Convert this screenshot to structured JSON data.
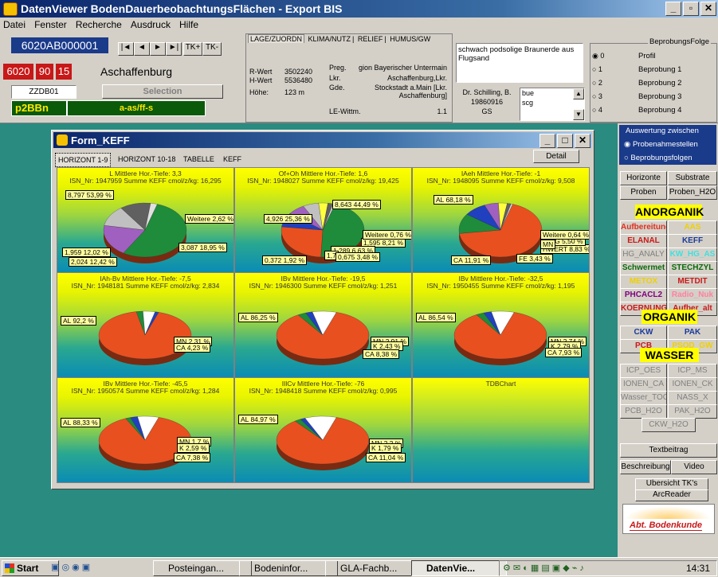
{
  "window": {
    "title": "DatenViewer BodenDauerbeobachtungsFlächen - Export BIS"
  },
  "menu": [
    "Datei",
    "Fenster",
    "Recherche",
    "Ausdruck",
    "Hilfe"
  ],
  "record": {
    "id": "6020AB000001",
    "code1": "6020",
    "code2": "90",
    "code3": "15",
    "place": "Aschaffenburg",
    "zzdb": "ZZDB01",
    "selection": "Selection",
    "p2bbn": "p2BBn",
    "horizon": "a-as/ff-s",
    "nav": [
      "|◄",
      "◄",
      "►",
      "►|"
    ],
    "tk_plus": "TK+",
    "tk_minus": "TK-"
  },
  "lagetabs": [
    "LAGE/ZUORDN",
    "KLIMA/NUTZ",
    "RELIEF",
    "HUMUS/GW"
  ],
  "lage": {
    "rwert_label": "R-Wert",
    "rwert": "3502240",
    "hwert_label": "H-Wert",
    "hwert": "5536480",
    "hoehe_label": "Höhe:",
    "hoehe": "123  m",
    "preg_label": "Preg.",
    "preg": "gion Bayerischer Untermain",
    "lkr_label": "Lkr.",
    "lkr": "Aschaffenburg,Lkr.",
    "gde_label": "Gde.",
    "gde": "Stockstadt a.Main [Lkr. Aschaffenburg]",
    "lewittm_label": "LE-Wittm.",
    "lewittm": "1.1"
  },
  "desc": {
    "text": "schwach podsolige Braunerde aus Flugsand",
    "author": "Dr. Schilling, B.",
    "date": "19860916",
    "gs": "GS",
    "list": [
      "bue",
      "scg"
    ]
  },
  "beprobung": {
    "title": "BeprobungsFolge",
    "options": [
      "0",
      "1",
      "2",
      "3",
      "4"
    ],
    "labels": [
      "Profil",
      "Beprobung 1",
      "Beprobung 2",
      "Beprobung 3",
      "Beprobung 4"
    ]
  },
  "keff": {
    "title": "Form_KEFF",
    "detail": "Detail",
    "tabs": [
      "HORIZONT 1-9",
      "HORIZONT 10-18",
      "TABELLE",
      "KEFF"
    ]
  },
  "chart_data": [
    {
      "type": "pie",
      "title": "L   Mittlere Hor.-Tiefe: 3,3",
      "subtitle": "ISN_Nr: 1947959  Summe KEFF cmol/z/kg: 16,295",
      "slices": [
        {
          "label": "8,797 53,99 %",
          "value": 53.99,
          "color": "#1e8c3a"
        },
        {
          "label": "3,087 18,95 %",
          "value": 18.95,
          "color": "#a060c0"
        },
        {
          "label": "2,024 12,42 %",
          "value": 12.42,
          "color": "#c0c0c0"
        },
        {
          "label": "1,959 12,02 %",
          "value": 12.02,
          "color": "#606060"
        },
        {
          "label": "Weitere 2,62 %",
          "value": 2.62,
          "color": "#e0e0e0"
        }
      ]
    },
    {
      "type": "pie",
      "title": "Of+Oh   Mittlere Hor.-Tiefe: 1,6",
      "subtitle": "ISN_Nr: 1948027  Summe KEFF cmol/z/kg: 19,425",
      "slices": [
        {
          "label": "8,643 44,49 %",
          "value": 44.49,
          "color": "#1e8c3a"
        },
        {
          "label": "4,926 25,36 %",
          "value": 25.36,
          "color": "#e85020"
        },
        {
          "label": "1,595 8,21 %",
          "value": 8.21,
          "color": "#2040c0"
        },
        {
          "label": "1,289 6,63 %",
          "value": 6.63,
          "color": "#a060c0"
        },
        {
          "label": "1,7",
          "value": 6.0,
          "color": "#c0c0c0"
        },
        {
          "label": "0,675 3,48 %",
          "value": 3.48,
          "color": "#ffff40"
        },
        {
          "label": "0,372 1,92 %",
          "value": 1.92,
          "color": "#606060"
        },
        {
          "label": "Weitere 0,76 %",
          "value": 0.76,
          "color": "#e0e0e0"
        }
      ]
    },
    {
      "type": "pie",
      "title": "IAeh   Mittlere Hor.-Tiefe: -1",
      "subtitle": "ISN_Nr: 1948095  Summe KEFF cmol/z/kg: 9,508",
      "slices": [
        {
          "label": "AL 68,18 %",
          "value": 68.18,
          "color": "#e85020"
        },
        {
          "label": "CA 11,91 %",
          "value": 11.91,
          "color": "#1e8c3a"
        },
        {
          "label": "HWERT 8,83 %",
          "value": 8.83,
          "color": "#2040c0"
        },
        {
          "label": "MG 5,50 %",
          "value": 5.5,
          "color": "#a060c0"
        },
        {
          "label": "FE 3,43 %",
          "value": 3.43,
          "color": "#ffff40"
        },
        {
          "label": "MN",
          "value": 1.5,
          "color": "#606060"
        },
        {
          "label": "Weitere 0,64 %",
          "value": 0.64,
          "color": "#e0e0e0"
        }
      ]
    },
    {
      "type": "pie",
      "title": "IAh-Bv   Mittlere Hor.-Tiefe: -7,5",
      "subtitle": "ISN_Nr: 1948181  Summe KEFF cmol/z/kg: 2,834",
      "slices": [
        {
          "label": "AL 92,2 %",
          "value": 92.2,
          "color": "#e85020"
        },
        {
          "label": "MN 2,31 %",
          "value": 2.31,
          "color": "#1e8c3a"
        },
        {
          "label": "CA 4,23 %",
          "value": 4.23,
          "color": "#ffffff"
        },
        {
          "label": "",
          "value": 1.26,
          "color": "#2040c0"
        }
      ]
    },
    {
      "type": "pie",
      "title": "IBv   Mittlere Hor.-Tiefe: -19,5",
      "subtitle": "ISN_Nr: 1946300  Summe KEFF cmol/z/kg: 1,251",
      "slices": [
        {
          "label": "AL 86,25 %",
          "value": 86.25,
          "color": "#e85020"
        },
        {
          "label": "MN 2,91 %",
          "value": 2.91,
          "color": "#1e8c3a"
        },
        {
          "label": "K 2,43 %",
          "value": 2.43,
          "color": "#2040c0"
        },
        {
          "label": "CA 8,38 %",
          "value": 8.38,
          "color": "#ffffff"
        }
      ]
    },
    {
      "type": "pie",
      "title": "IBv   Mittlere Hor.-Tiefe: -32,5",
      "subtitle": "ISN_Nr: 1950455  Summe KEFF cmol/z/kg: 1,195",
      "slices": [
        {
          "label": "AL 86,54 %",
          "value": 86.54,
          "color": "#e85020"
        },
        {
          "label": "MN 2,74 %",
          "value": 2.74,
          "color": "#1e8c3a"
        },
        {
          "label": "K 2,79 %",
          "value": 2.79,
          "color": "#2040c0"
        },
        {
          "label": "CA 7,93 %",
          "value": 7.93,
          "color": "#ffffff"
        }
      ]
    },
    {
      "type": "pie",
      "title": "IBv   Mittlere Hor.-Tiefe: -45,5",
      "subtitle": "ISN_Nr: 1950574  Summe KEFF cmol/z/kg: 1,284",
      "slices": [
        {
          "label": "AL 88,33 %",
          "value": 88.33,
          "color": "#e85020"
        },
        {
          "label": "MN 1,7 %",
          "value": 1.7,
          "color": "#1e8c3a"
        },
        {
          "label": "K 2,59 %",
          "value": 2.59,
          "color": "#2040c0"
        },
        {
          "label": "CA 7,38 %",
          "value": 7.38,
          "color": "#ffffff"
        }
      ]
    },
    {
      "type": "pie",
      "title": "IIlCv   Mittlere Hor.-Tiefe: -76",
      "subtitle": "ISN_Nr: 1948418  Summe KEFF cmol/z/kg: 0,995",
      "slices": [
        {
          "label": "AL 84,97 %",
          "value": 84.97,
          "color": "#e85020"
        },
        {
          "label": "MN 2,2 %",
          "value": 2.2,
          "color": "#1e8c3a"
        },
        {
          "label": "K 1,79 %",
          "value": 1.79,
          "color": "#2040c0"
        },
        {
          "label": "CA 11,04 %",
          "value": 11.04,
          "color": "#ffffff"
        }
      ]
    },
    {
      "type": "pie",
      "title": "TDBChart",
      "subtitle": "",
      "slices": []
    }
  ],
  "auswertung": {
    "title": "Auswertung zwischen",
    "options": [
      "Probenahmestellen",
      "Beprobungsfolgen"
    ],
    "row1": [
      "Horizonte",
      "Substrate"
    ],
    "row2": [
      "Proben",
      "Proben_H2O"
    ]
  },
  "anorganik": {
    "title": "ANORGANIK",
    "buttons": [
      "Aufbereitung",
      "AAS",
      "ELANAL",
      "KEFF",
      "HG_ANALY",
      "KW_HG_AS",
      "Schwermet",
      "STECHZYL",
      "METOX",
      "METDIT",
      "PHCACL2",
      "Radio_Nuk",
      "KOERNUNG",
      "Aufber_alt"
    ]
  },
  "organik": {
    "title": "ORGANIK",
    "buttons": [
      "CKW",
      "PAK",
      "PCB",
      "PSOD_GW"
    ]
  },
  "wasser": {
    "title": "WASSER",
    "buttons": [
      "ICP_OES",
      "ICP_MS",
      "IONEN_CA",
      "IONEN_CK",
      "Wasser_TOC",
      "NASS_X",
      "PCB_H2O",
      "PAK_H2O",
      "CKW_H2O"
    ]
  },
  "extra": {
    "textbeitrag": "Textbeitrag",
    "beschreibung": "Beschreibung",
    "video": "Video",
    "uebersicht": "Ubersicht TK's",
    "arcreader": "ArcReader",
    "logo": "Abt. Bodenkunde"
  },
  "taskbar": {
    "start": "Start",
    "items": [
      "Posteingan...",
      "Bodeninfor...",
      "GLA-Fachb...",
      "DatenVie..."
    ],
    "clock": "14:31"
  }
}
